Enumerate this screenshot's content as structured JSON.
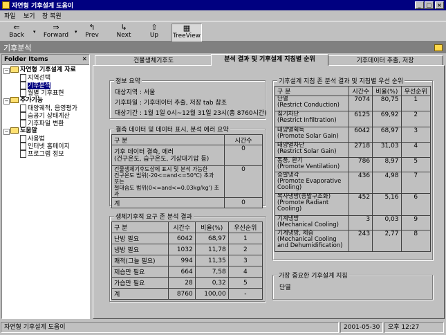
{
  "window": {
    "title": "자연형 기후설계 도움이"
  },
  "menu": [
    "파일",
    "보기",
    "창 복원"
  ],
  "toolbar": {
    "back": "Back",
    "forward": "Forward",
    "prev": "Prev",
    "next": "Next",
    "up": "Up",
    "treeview": "TreeView"
  },
  "header": {
    "title": "기후분석"
  },
  "folder": {
    "title": "Folder Items",
    "nodes": [
      {
        "label": "자연형 기후설계 자료"
      },
      {
        "label": "지역선택"
      },
      {
        "label": "기후분석"
      },
      {
        "label": "월별 기후표현"
      },
      {
        "label": "추가기능"
      },
      {
        "label": "태양궤적, 음영평가"
      },
      {
        "label": "습공기 상태계산"
      },
      {
        "label": "기후파일 변환"
      },
      {
        "label": "도움말"
      },
      {
        "label": "사용법"
      },
      {
        "label": "인터넷 홈페이지"
      },
      {
        "label": "프로그램 정보"
      }
    ]
  },
  "tabs": [
    "건물생체기후도",
    "분석 결과 및 기후설계 지침별 순위",
    "기후데이터 추출, 저장"
  ],
  "info": {
    "title": "정보 요약",
    "region": "대상지역 : 서울",
    "file": "기후파일 : 기후데이터 추출, 저장 tab 참조",
    "period": "대상기간 : 1월 1일 0시~12월 31일 23시(총 8760시간)"
  },
  "missing": {
    "title": "결측 데이터 및 데이터 표시, 분석 에러 요약",
    "headers": [
      "구  분",
      "시간수"
    ],
    "rows": [
      {
        "label": "기후 데이터 결측, 에러\n(건구온도, 습구온도, 기상대기압 등)",
        "value": "0"
      },
      {
        "label": "건물생체기후도상에 표시 및 분석 가능한\n건구온도 범위(-20<=and<=50℃) 초과\n또는\n절대습도 범위(0<=and<=0.03kg/kg') 초과",
        "value": "0"
      },
      {
        "label": "계",
        "value": "0"
      }
    ]
  },
  "bio": {
    "title": "생체기후적 요구 존 분석 결과",
    "headers": [
      "구  분",
      "시간수",
      "비율(%)",
      "우선순위"
    ],
    "rows": [
      {
        "label": "난방 필요",
        "hours": "6042",
        "pct": "68,97",
        "rank": "1"
      },
      {
        "label": "냉방 필요",
        "hours": "1032",
        "pct": "11,78",
        "rank": "2"
      },
      {
        "label": "쾌적(그늘 필요)",
        "hours": "994",
        "pct": "11,35",
        "rank": "3"
      },
      {
        "label": "제습만 필요",
        "hours": "664",
        "pct": "7,58",
        "rank": "4"
      },
      {
        "label": "가습만 필요",
        "hours": "28",
        "pct": "0,32",
        "rank": "5"
      },
      {
        "label": "계",
        "hours": "8760",
        "pct": "100,00",
        "rank": "-"
      }
    ]
  },
  "strategy": {
    "title": "기후설계 지침 존 분석 결과 및 지침별 우선 순위",
    "headers": [
      "구  분",
      "시간수",
      "비율(%)",
      "우선순위"
    ],
    "rows": [
      {
        "label": "단열\n(Restrict Conduction)",
        "hours": "7074",
        "pct": "80,75",
        "rank": "1"
      },
      {
        "label": "침기차단\n(Restrict Infiltration)",
        "hours": "6125",
        "pct": "69,92",
        "rank": "2"
      },
      {
        "label": "태양열획득\n(Promote Solar Gain)",
        "hours": "6042",
        "pct": "68,97",
        "rank": "3"
      },
      {
        "label": "태양열차단\n(Restrict Solar Gain)",
        "hours": "2718",
        "pct": "31,03",
        "rank": "4"
      },
      {
        "label": "통풍, 환기\n(Promote Ventilation)",
        "hours": "786",
        "pct": "8,97",
        "rank": "5"
      },
      {
        "label": "증발냉각\n(Promote Evaporative\nCooling)",
        "hours": "436",
        "pct": "4,98",
        "rank": "7"
      },
      {
        "label": "복사냉방(증발구조화)\n(Promote Radiant\nCooling)",
        "hours": "452",
        "pct": "5,16",
        "rank": "6"
      },
      {
        "label": "기계냉방\n(Mechanical Cooling)",
        "hours": "3",
        "pct": "0,03",
        "rank": "9"
      },
      {
        "label": "기계냉방, 제습\n(Mechanical Cooling\nand Dehumidification)",
        "hours": "243",
        "pct": "2,77",
        "rank": "8"
      }
    ]
  },
  "important": {
    "title": "가장 중요한 기후설계 지침",
    "value": "단열"
  },
  "status": {
    "text": "자연형 기후설계 도움이",
    "date": "2001-05-30",
    "time": "오후 12:27"
  }
}
